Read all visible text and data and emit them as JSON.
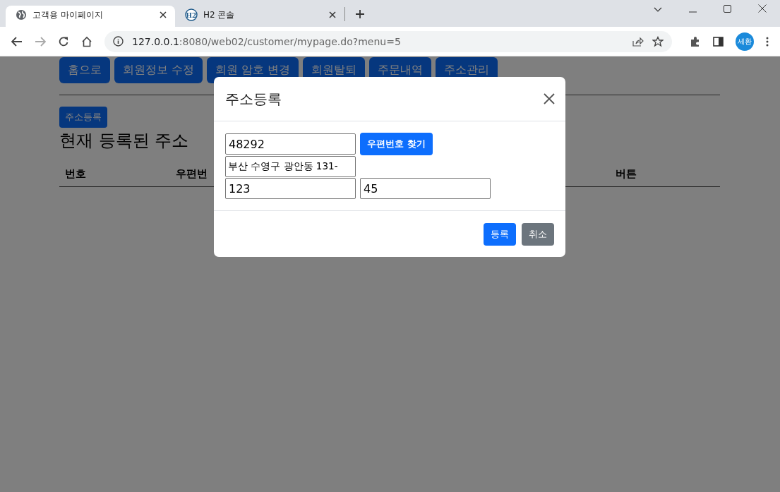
{
  "browser": {
    "tabs": [
      {
        "title": "고객용 마이페이지",
        "kind": "globe",
        "selected": true
      },
      {
        "title": "H2 콘솔",
        "kind": "logo",
        "logo_text": "H2",
        "selected": false
      }
    ],
    "url_host": "127.0.0.1",
    "url_path": ":8080/web02/customer/mypage.do?menu=5",
    "profile": "세환"
  },
  "page": {
    "nav_buttons": [
      "홈으로",
      "회원정보 수정",
      "회원 암호 변경",
      "회원탈퇴",
      "주문내역",
      "주소관리"
    ],
    "register_button": "주소등록",
    "heading": "현재 등록된 주소",
    "table_columns": [
      "번호",
      "우편번",
      "버튼"
    ]
  },
  "modal": {
    "title": "주소등록",
    "fields": [
      {
        "value": "48292"
      },
      {
        "value": "부산 수영구 광안동 131-"
      },
      {
        "value": "123"
      },
      {
        "value": "45"
      }
    ],
    "search_button": "우편번호 찾기",
    "footer_buttons": [
      {
        "label": "등록",
        "kind": "primary"
      },
      {
        "label": "취소",
        "kind": "secondary"
      }
    ]
  }
}
